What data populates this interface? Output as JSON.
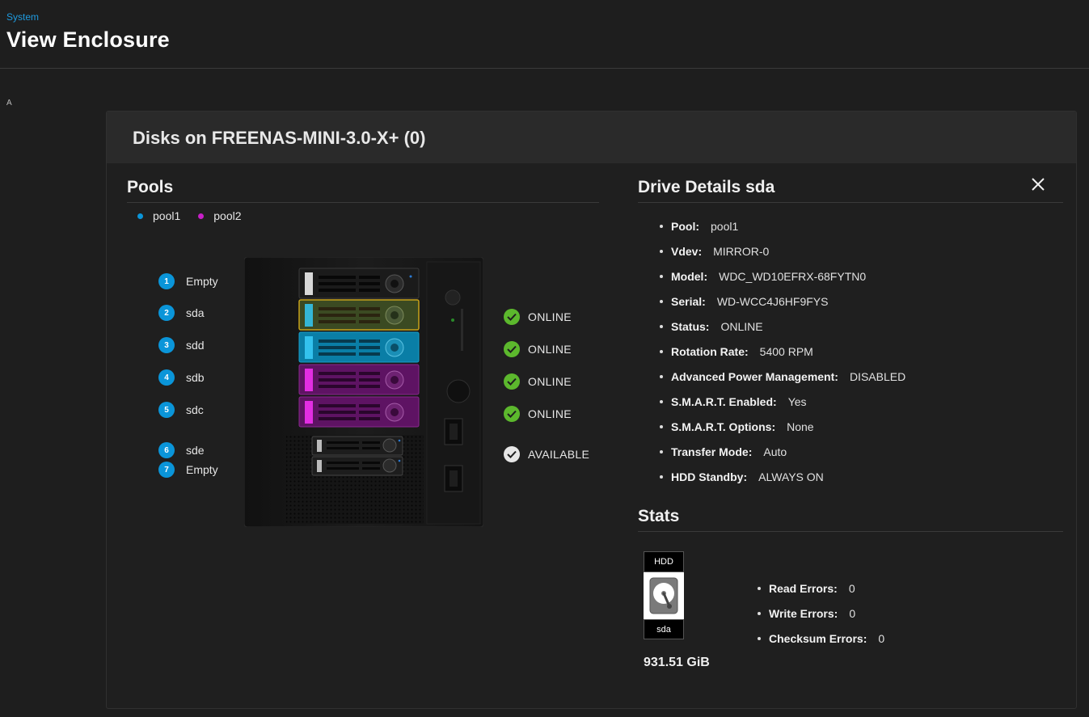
{
  "breadcrumb": "System",
  "page_title": "View Enclosure",
  "stray_text": "A",
  "card": {
    "title": "Disks on FREENAS-MINI-3.0-X+ (0)",
    "pools": {
      "heading": "Pools",
      "legend": [
        {
          "name": "pool1",
          "color": "#0a95d9"
        },
        {
          "name": "pool2",
          "color": "#c71fc7"
        }
      ]
    },
    "slots": [
      {
        "number": "1",
        "label": "Empty"
      },
      {
        "number": "2",
        "label": "sda"
      },
      {
        "number": "3",
        "label": "sdd"
      },
      {
        "number": "4",
        "label": "sdb"
      },
      {
        "number": "5",
        "label": "sdc"
      },
      {
        "number": "6",
        "label": "sde"
      },
      {
        "number": "7",
        "label": "Empty"
      }
    ],
    "statuses": [
      {
        "label": "ONLINE",
        "color": "#5cb82d"
      },
      {
        "label": "ONLINE",
        "color": "#5cb82d"
      },
      {
        "label": "ONLINE",
        "color": "#5cb82d"
      },
      {
        "label": "ONLINE",
        "color": "#5cb82d"
      },
      {
        "label": "AVAILABLE",
        "color": "#e6e6e6"
      }
    ],
    "drive_details": {
      "heading": "Drive Details sda",
      "items": [
        {
          "key": "Pool:",
          "value": "pool1"
        },
        {
          "key": "Vdev:",
          "value": "MIRROR-0"
        },
        {
          "key": "Model:",
          "value": "WDC_WD10EFRX-68FYTN0"
        },
        {
          "key": "Serial:",
          "value": "WD-WCC4J6HF9FYS"
        },
        {
          "key": "Status:",
          "value": "ONLINE"
        },
        {
          "key": "Rotation Rate:",
          "value": "5400 RPM"
        },
        {
          "key": "Advanced Power Management:",
          "value": "DISABLED"
        },
        {
          "key": "S.M.A.R.T. Enabled:",
          "value": "Yes"
        },
        {
          "key": "S.M.A.R.T. Options:",
          "value": "None"
        },
        {
          "key": "Transfer Mode:",
          "value": "Auto"
        },
        {
          "key": "HDD Standby:",
          "value": "ALWAYS ON"
        }
      ]
    },
    "stats": {
      "heading": "Stats",
      "hdd_type": "HDD",
      "hdd_name": "sda",
      "capacity": "931.51 GiB",
      "items": [
        {
          "key": "Read Errors:",
          "value": "0"
        },
        {
          "key": "Write Errors:",
          "value": "0"
        },
        {
          "key": "Checksum Errors:",
          "value": "0"
        }
      ]
    },
    "icons": {
      "close": "close-icon",
      "check": "check-circle-icon",
      "hdd": "hard-drive-icon"
    },
    "colors": {
      "accent": "#0a95d9",
      "pool1": "#0a95d9",
      "pool2": "#c71fc7",
      "selected": "#c7a21a",
      "online": "#5cb82d"
    }
  }
}
